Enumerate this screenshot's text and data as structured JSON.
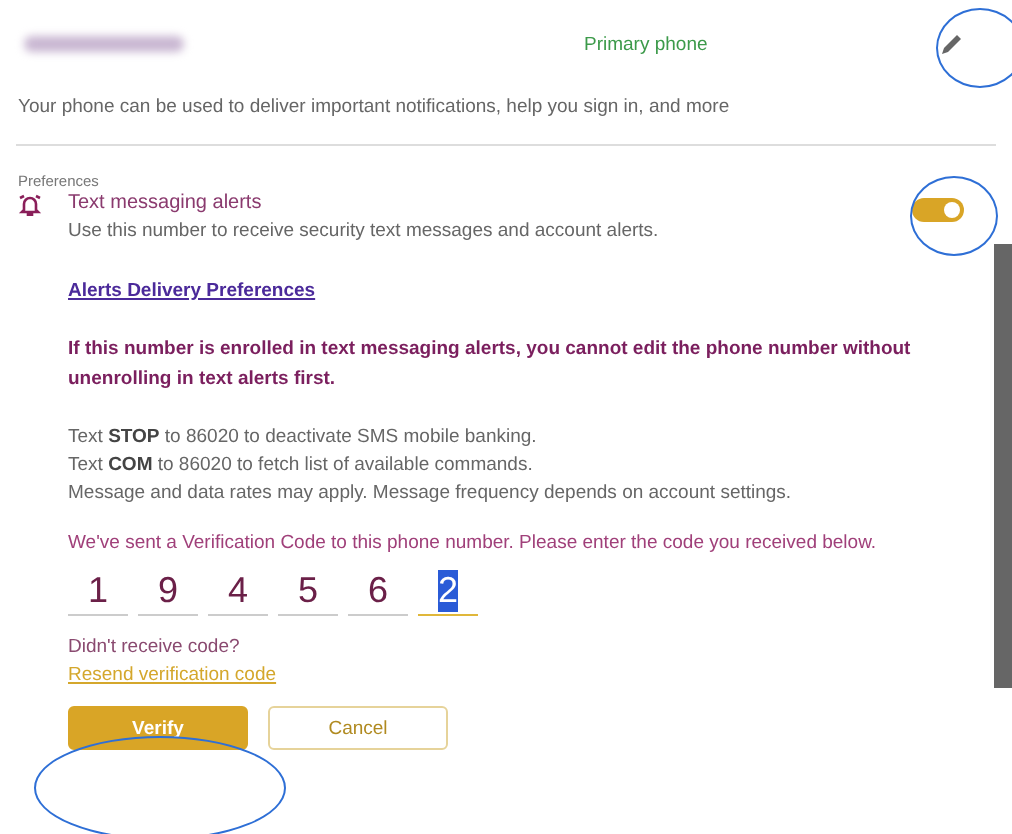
{
  "phone": {
    "label": "Primary phone",
    "description": "Your phone can be used to deliver important notifications, help you sign in, and more"
  },
  "preferences": {
    "heading": "Preferences",
    "alert_title": "Text messaging alerts",
    "alert_subtitle": "Use this number to receive security text messages and account alerts.",
    "alerts_on": true,
    "link": "Alerts Delivery Preferences",
    "warning": "If this number is enrolled in text messaging alerts, you cannot edit the phone number without unenrolling in text alerts first.",
    "info_lines": [
      "Text **STOP** to 86020 to deactivate SMS mobile banking.",
      "Text **COM** to 86020 to fetch list of available commands.",
      "Message and data rates may apply. Message frequency depends on account settings."
    ]
  },
  "verification": {
    "prompt": "We've sent a Verification Code to this phone number. Please enter the code you received below.",
    "digits": [
      {
        "value": "1",
        "focused": false
      },
      {
        "value": "9",
        "focused": false
      },
      {
        "value": "4",
        "focused": false
      },
      {
        "value": "5",
        "focused": false
      },
      {
        "value": "6",
        "focused": false
      },
      {
        "value": "2",
        "focused": true
      }
    ],
    "no_code": "Didn't receive code?",
    "resend": "Resend verification code"
  },
  "buttons": [
    {
      "label": "Verify",
      "kind": "primary"
    },
    {
      "label": "Cancel",
      "kind": "secondary"
    }
  ]
}
